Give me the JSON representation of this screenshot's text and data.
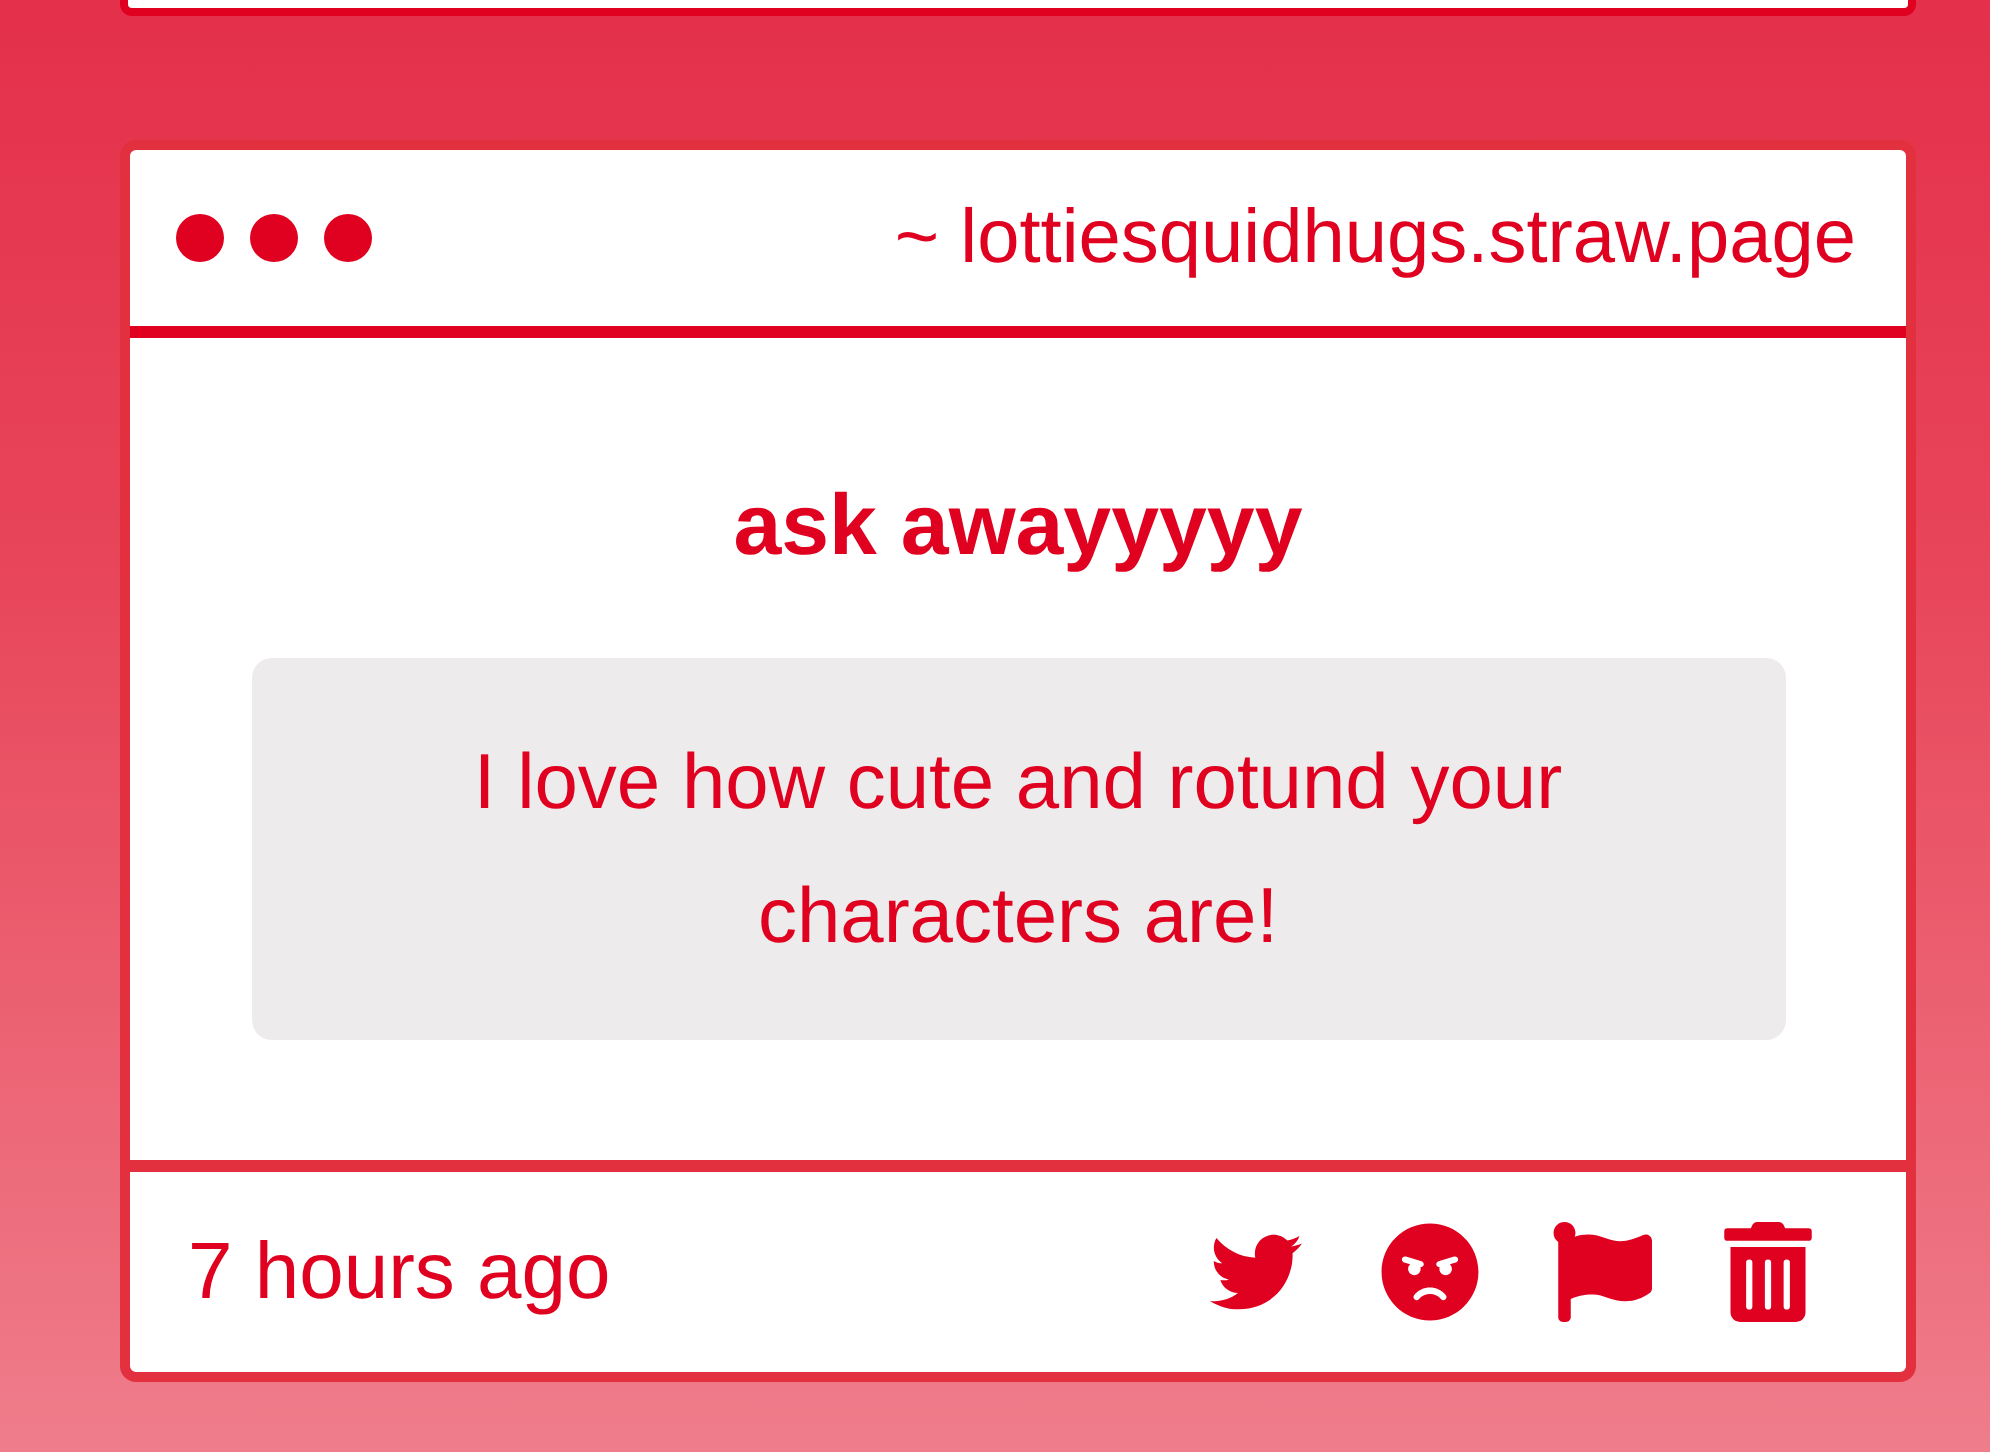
{
  "card": {
    "url": "~ lottiesquidhugs.straw.page",
    "title": "ask awayyyyy",
    "message": "I love how cute and rotund your characters are!",
    "time": "7 hours ago"
  },
  "actions": [
    {
      "kind": "share"
    },
    {
      "kind": "react"
    },
    {
      "kind": "report"
    },
    {
      "kind": "delete"
    }
  ]
}
